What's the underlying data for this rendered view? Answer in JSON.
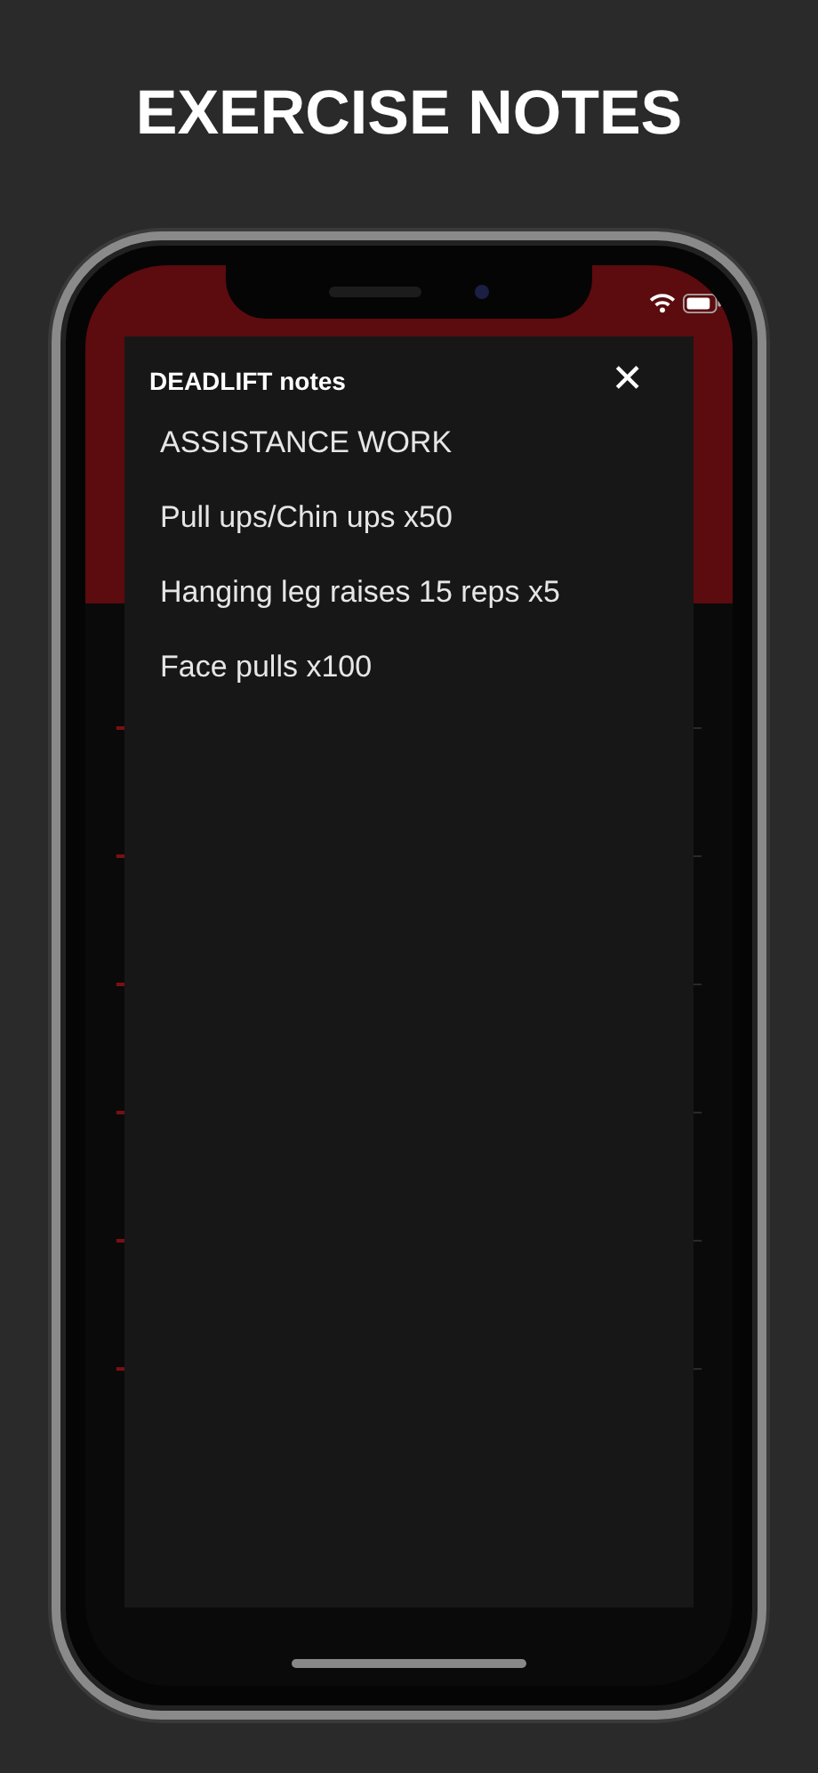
{
  "headline": "EXERCISE NOTES",
  "modal": {
    "title": "DEADLIFT notes",
    "close": "✕",
    "notes": [
      "ASSISTANCE WORK",
      "Pull ups/Chin ups x50",
      "Hanging leg raises 15 reps x5",
      "Face pulls x100"
    ]
  }
}
